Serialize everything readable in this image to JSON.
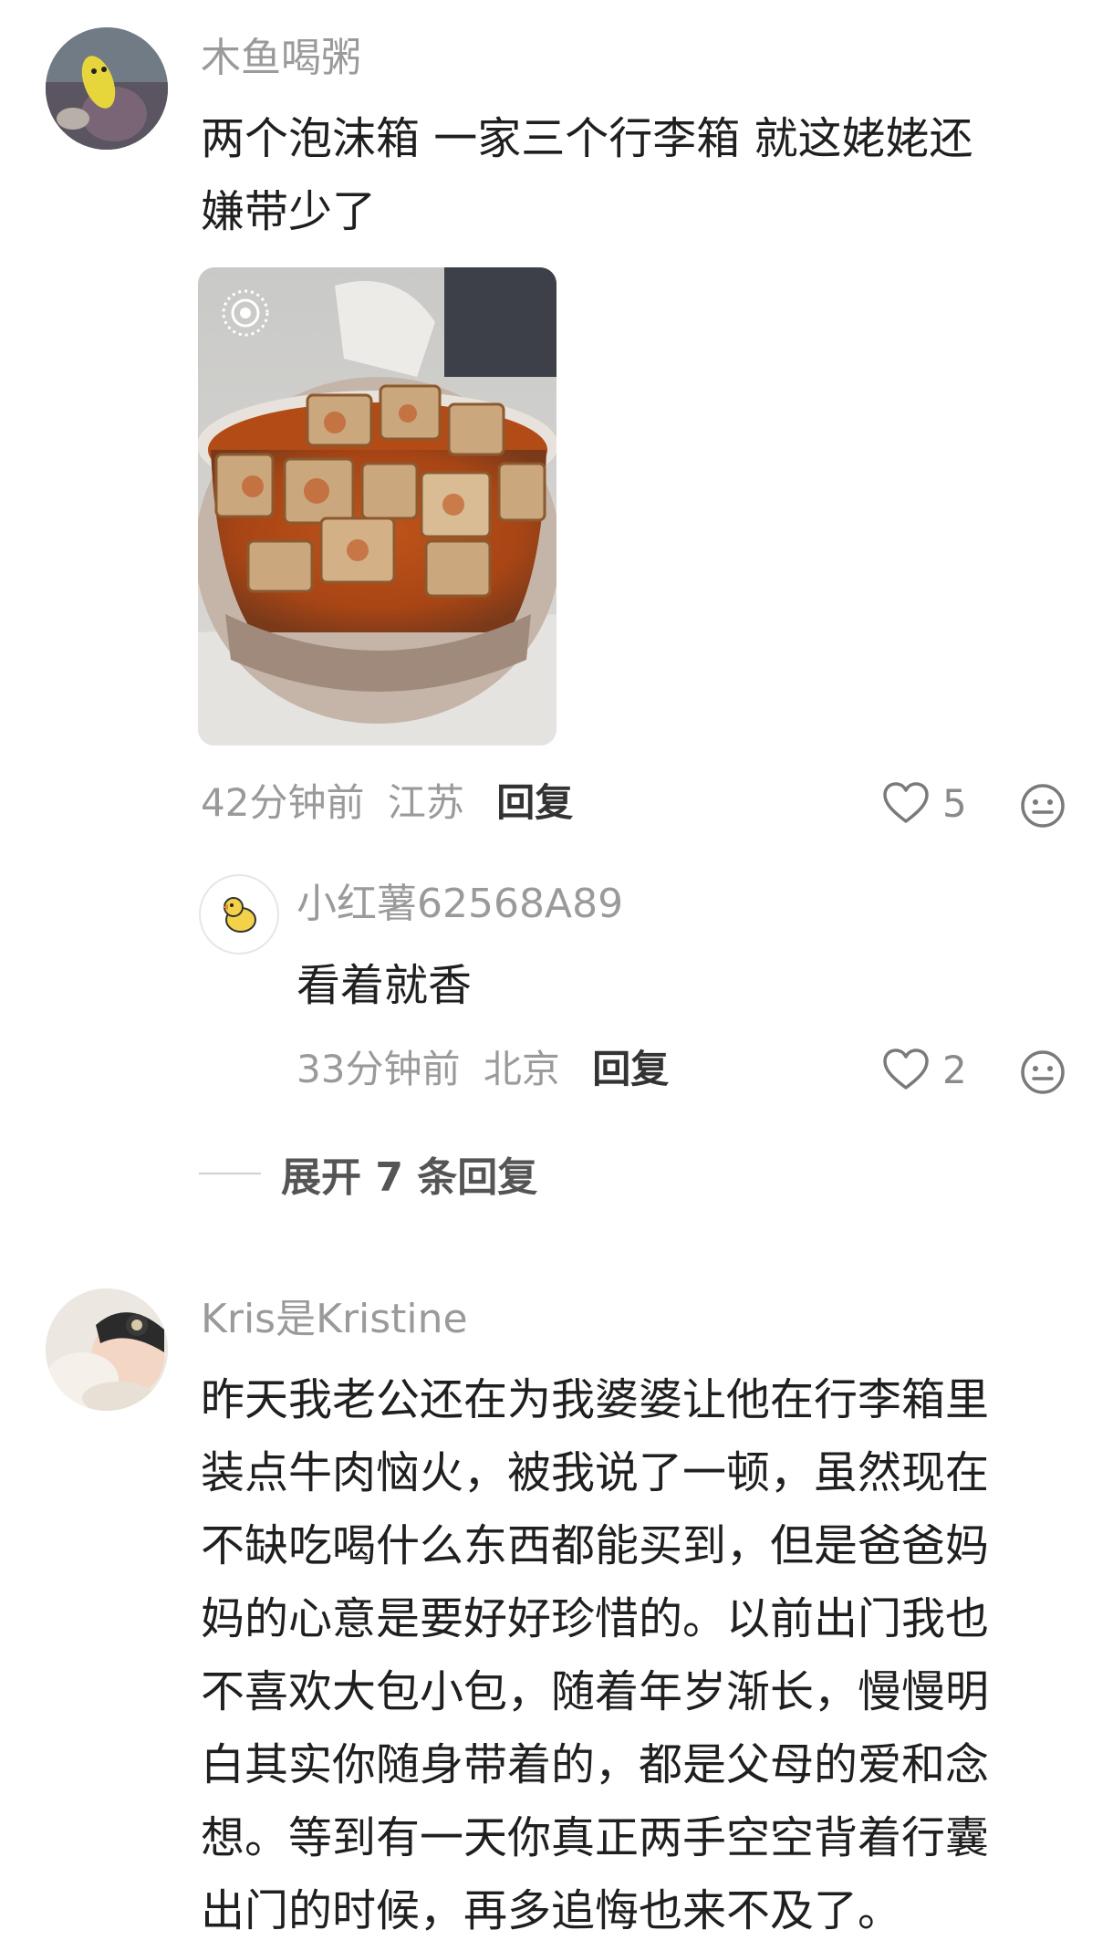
{
  "comments": [
    {
      "username": "木鱼喝粥",
      "text_lines": [
        "两个泡沫箱 一家三个行李箱 就这姥姥还",
        "嫌带少了"
      ],
      "time": "42分钟前",
      "location": "江苏",
      "reply_label": "回复",
      "likes": "5",
      "image_icon": "live-photo-icon",
      "replies": [
        {
          "username": "小红薯62568A89",
          "text": "看着就香",
          "time": "33分钟前",
          "location": "北京",
          "reply_label": "回复",
          "likes": "2"
        }
      ],
      "expand_label": "展开 7 条回复"
    },
    {
      "username": "Kris是Kristine",
      "text_lines": [
        "昨天我老公还在为我婆婆让他在行李箱里",
        "装点牛肉恼火，被我说了一顿，虽然现在",
        "不缺吃喝什么东西都能买到，但是爸爸妈",
        "妈的心意是要好好珍惜的。以前出门我也",
        "不喜欢大包小包，随着年岁渐长，慢慢明",
        "白其实你随身带着的，都是父母的爱和念",
        "想。等到有一天你真正两手空空背着行囊",
        "出门的时候，再多追悔也来不及了。"
      ]
    }
  ],
  "colors": {
    "username": "#9a9a9a",
    "text": "#1f1f1f",
    "meta": "#9a9a9a",
    "icon": "#8a8a8a"
  }
}
